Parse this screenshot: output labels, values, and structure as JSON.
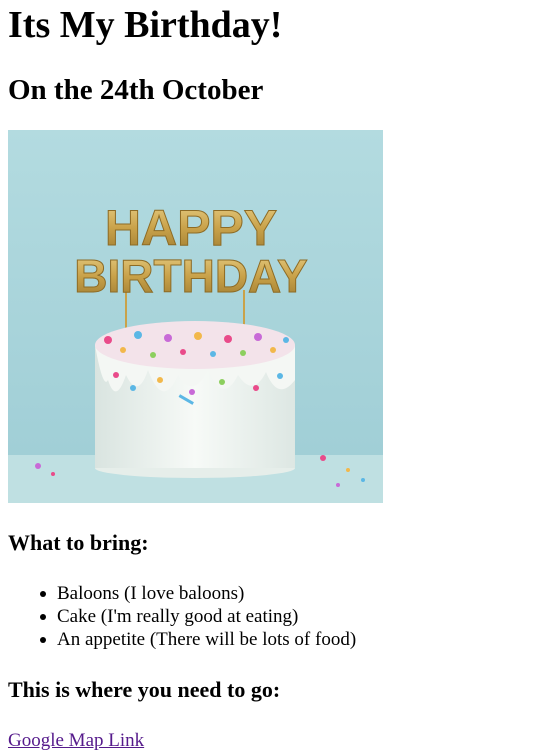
{
  "page": {
    "title": "Its My Birthday!",
    "subtitle": "On the 24th October"
  },
  "image": {
    "icon": "birthday-cake-image",
    "topper_line1": "HAPPY",
    "topper_line2": "BIRTHDAY",
    "colors": {
      "background": "#a9d5dc",
      "cake": "#eef3ef",
      "topper_gold": "#c9a24a"
    }
  },
  "bring": {
    "heading": "What to bring:",
    "items": [
      "Baloons (I love baloons)",
      "Cake (I'm really good at eating)",
      "An appetite (There will be lots of food)"
    ]
  },
  "location": {
    "heading": "This is where you need to go:",
    "link_label": "Google Map Link",
    "link_color": "#551a8b"
  }
}
